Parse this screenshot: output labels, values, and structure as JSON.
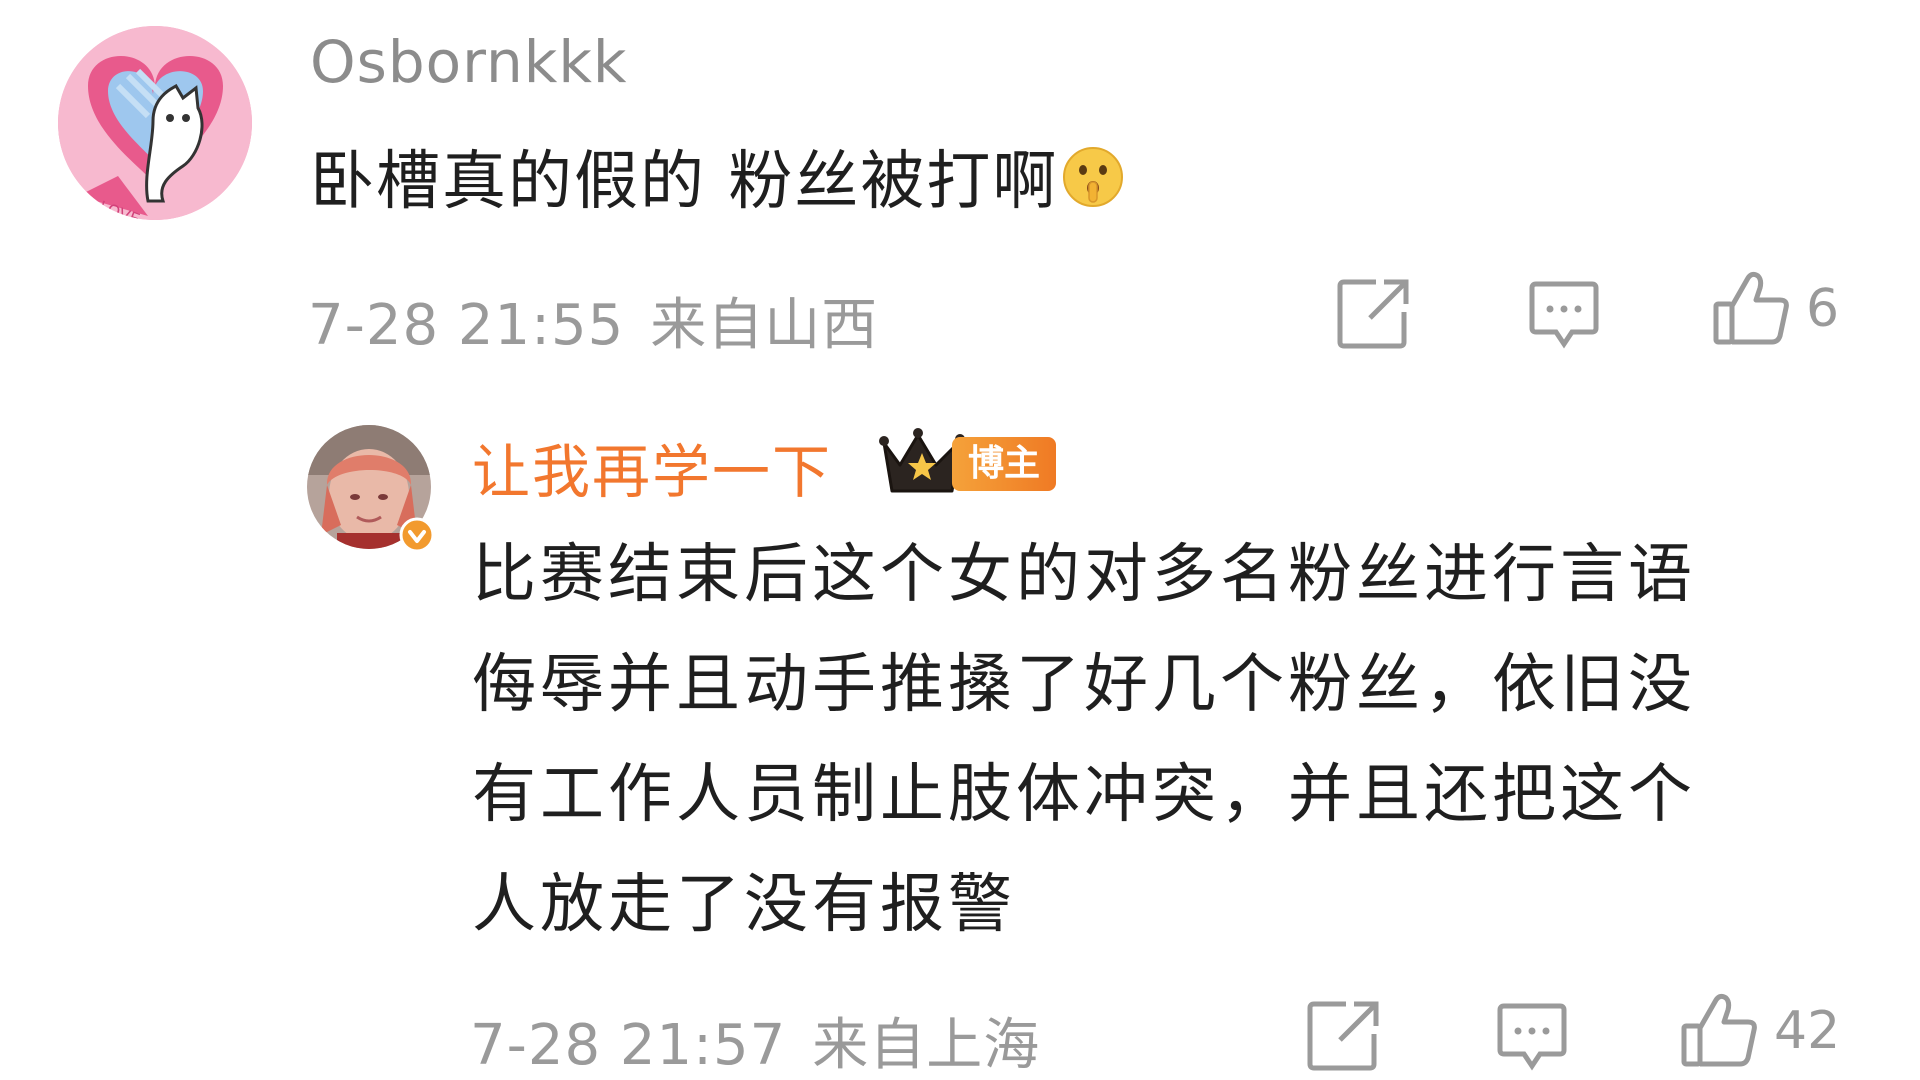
{
  "comments": [
    {
      "username": "Osbornkkk",
      "text": "卧槽真的假的 粉丝被打啊",
      "emoji": "shushing-face-emoji",
      "time": "7-28 21:55",
      "location": "来自山西",
      "likes": "6"
    },
    {
      "username": "让我再学一下",
      "badge": "博主",
      "text_lines": [
        "比赛结束后这个女的对多名粉丝进行言语",
        "侮辱并且动手推搡了好几个粉丝，依旧没",
        "有工作人员制止肢体冲突，并且还把这个",
        "人放走了没有报警"
      ],
      "time": "7-28 21:57",
      "location": "来自上海",
      "likes": "42"
    }
  ],
  "colors": {
    "username_gray": "#8c8c8c",
    "author_orange": "#f2772e",
    "meta_gray": "#9a9a9a",
    "text": "#1f1f1f"
  }
}
